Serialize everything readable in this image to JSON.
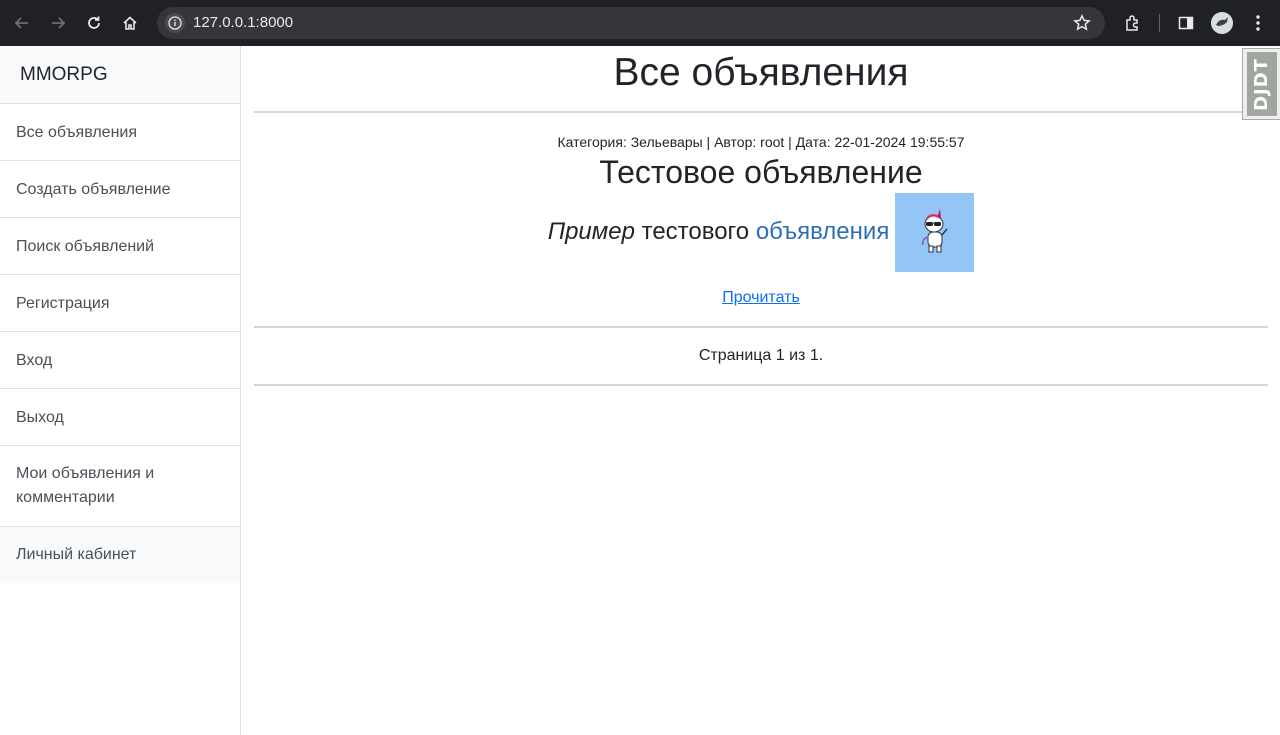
{
  "browser": {
    "url": "127.0.0.1:8000",
    "icons": [
      "back-arrow-icon",
      "forward-arrow-icon",
      "reload-icon",
      "home-icon",
      "info-icon",
      "star-icon",
      "extensions-icon",
      "side-panel-icon",
      "profile-avatar",
      "kebab-menu-icon"
    ]
  },
  "sidebar": {
    "brand": "MMORPG",
    "items": [
      {
        "label": "Все объявления"
      },
      {
        "label": "Создать объявление"
      },
      {
        "label": "Поиск объявлений"
      },
      {
        "label": "Регистрация"
      },
      {
        "label": "Вход"
      },
      {
        "label": "Выход"
      },
      {
        "label": "Мои объявления и комментарии"
      },
      {
        "label": "Личный кабинет"
      }
    ]
  },
  "main": {
    "title": "Все объявления",
    "post": {
      "meta": "Категория: Зельевары | Автор: root | Дата: 22-01-2024 19:55:57",
      "title": "Тестовое объявление",
      "body_em": "Пример",
      "body_plain": " тестового ",
      "body_link": "объявления",
      "image_bg": "#93c6f7",
      "read_label": "Прочитать"
    },
    "pager": "Страница 1 из 1."
  },
  "debug_toolbar": {
    "label": "DJDT"
  },
  "colors": {
    "link": "#0d6efd",
    "post_link": "#2f6fb5",
    "chrome_bg": "#202124"
  }
}
